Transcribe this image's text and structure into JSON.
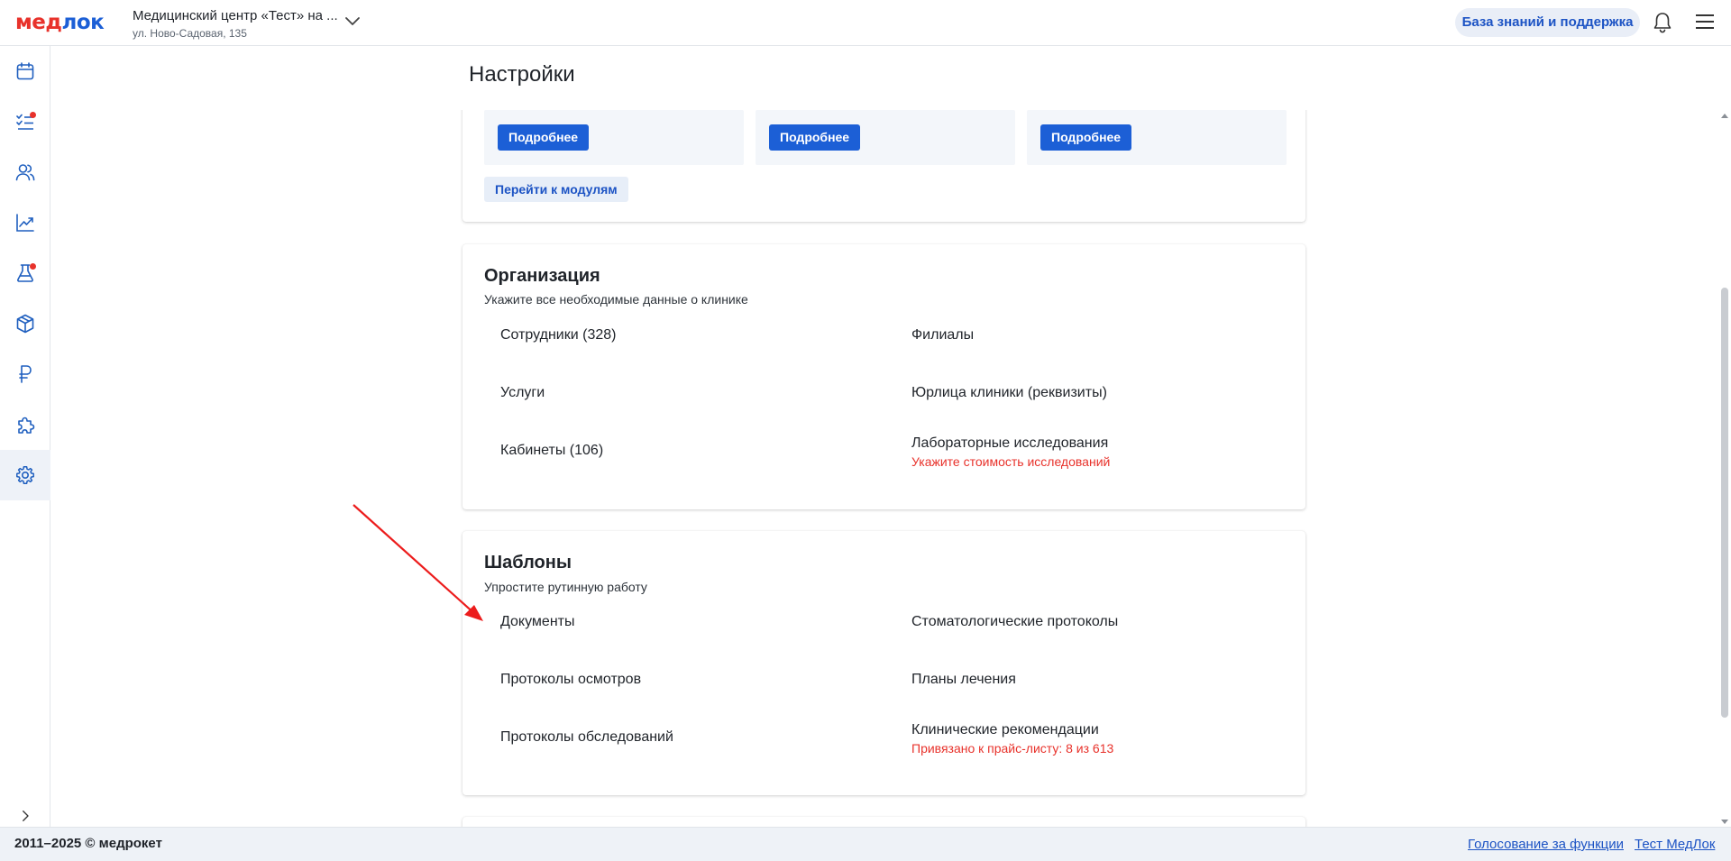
{
  "header": {
    "logo_main": "медлок",
    "clinic_name": "Медицинский центр «Тест» на ...",
    "clinic_address": "ул. Ново-Садовая, 135",
    "help_label": "База знаний и поддержка"
  },
  "sidebar": {
    "items": [
      {
        "name": "calendar-icon"
      },
      {
        "name": "tasks-icon",
        "badge": true
      },
      {
        "name": "users-icon"
      },
      {
        "name": "analytics-icon"
      },
      {
        "name": "lab-flask-icon",
        "badge": true
      },
      {
        "name": "box-icon"
      },
      {
        "name": "ruble-icon"
      },
      {
        "name": "puzzle-icon"
      },
      {
        "name": "gear-icon",
        "active": true
      }
    ],
    "expand_icon": "chevron-right-icon"
  },
  "page": {
    "title": "Настройки"
  },
  "modules_card": {
    "details_label": "Подробнее",
    "goto_modules_label": "Перейти к модулям"
  },
  "organization": {
    "title": "Организация",
    "subtitle": "Укажите все необходимые данные о клинике",
    "left": [
      "Сотрудники (328)",
      "Услуги",
      "Кабинеты (106)"
    ],
    "right": [
      "Филиалы",
      "Юрлица клиники (реквизиты)",
      "Лабораторные исследования"
    ],
    "lab_note": "Укажите стоимость исследований"
  },
  "templates": {
    "title": "Шаблоны",
    "subtitle": "Упростите рутинную работу",
    "left": [
      "Документы",
      "Протоколы осмотров",
      "Протоколы обследований"
    ],
    "right": [
      "Стоматологические протоколы",
      "Планы лечения",
      "Клинические рекомендации"
    ],
    "recommendations_note": "Привязано к прайс-листу: 8 из 613"
  },
  "footer": {
    "copyright": "2011–2025 © медрокет",
    "vote_link": "Голосование за функции",
    "test_link": "Тест МедЛок"
  },
  "colors": {
    "brand_red": "#e8322b",
    "brand_blue": "#1c5fd6",
    "link_blue": "#1c53c4",
    "warning_red": "#e8322b"
  }
}
